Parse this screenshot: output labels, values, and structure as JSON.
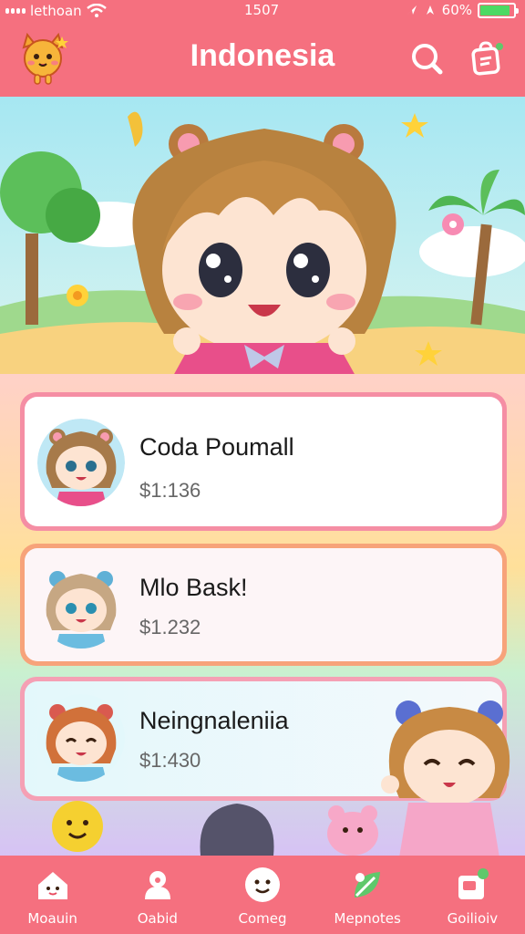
{
  "status_bar": {
    "carrier": "lethoan",
    "time": "1507",
    "battery": "60%",
    "battery_level": 0.9
  },
  "header": {
    "title": "Indonesia",
    "mascot_icon": "cat-mascot-icon",
    "search_icon": "search-icon",
    "bag_icon": "shopping-bag-icon"
  },
  "hero": {
    "image": "chibi-girl-banner"
  },
  "cards": [
    {
      "name": "Coda Poumall",
      "price": "$1:136",
      "avatar": "chibi-girl-bear-ears"
    },
    {
      "name": "Mlo Bask!",
      "price": "$1.232",
      "avatar": "chibi-girl-blue-ears"
    },
    {
      "name": "Neingnaleniia",
      "price": "$1:430",
      "avatar": "chibi-girl-red-ears"
    }
  ],
  "bottom_nav": {
    "items": [
      {
        "label": "Moauin",
        "icon": "home-icon"
      },
      {
        "label": "Oabid",
        "icon": "person-icon"
      },
      {
        "label": "Comeg",
        "icon": "smile-icon"
      },
      {
        "label": "Mepnotes",
        "icon": "leaf-icon"
      },
      {
        "label": "Goilioiv",
        "icon": "gift-icon"
      }
    ]
  },
  "colors": {
    "brand": "#f5707f",
    "card1_border": "#f58ea4",
    "card2_border": "#f7a37a",
    "card3_border": "#f5a0b4"
  }
}
